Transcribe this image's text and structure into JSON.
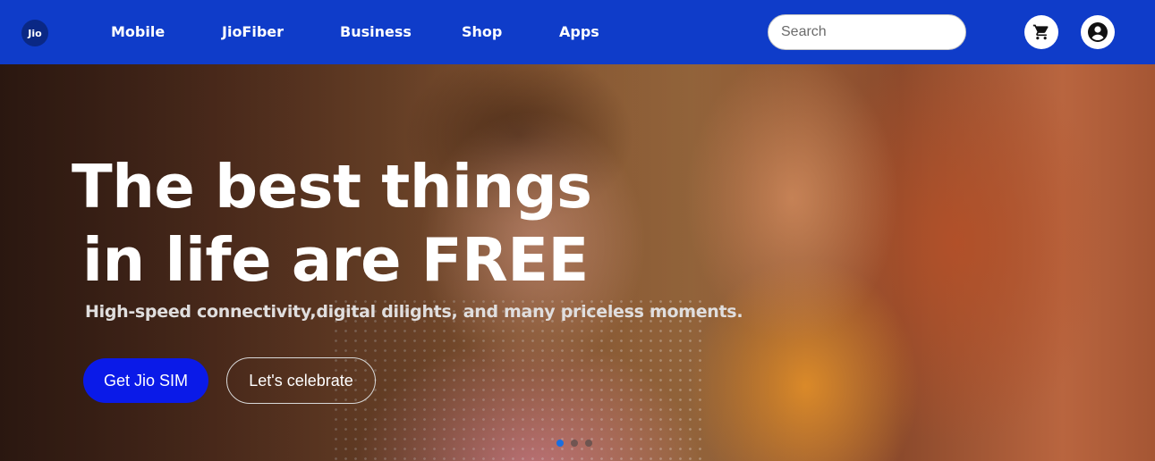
{
  "nav": {
    "logo_text": "Jio",
    "links": [
      "Mobile",
      "JioFiber",
      "Business",
      "Shop",
      "Apps"
    ],
    "search_placeholder": "Search",
    "cart_icon": "cart-icon",
    "account_icon": "account-circle-icon"
  },
  "hero": {
    "headline_line1": "The best things",
    "headline_line2": "in life are FREE",
    "subtitle": "High-speed connectivity,digital dilights, and many priceless moments.",
    "primary_button": "Get Jio SIM",
    "secondary_button": "Let's celebrate",
    "carousel": {
      "total": 3,
      "active": 1
    }
  },
  "colors": {
    "nav_background": "#0f3cc9",
    "primary_button": "#0a1ae8",
    "active_dot": "#1a6ee0"
  }
}
